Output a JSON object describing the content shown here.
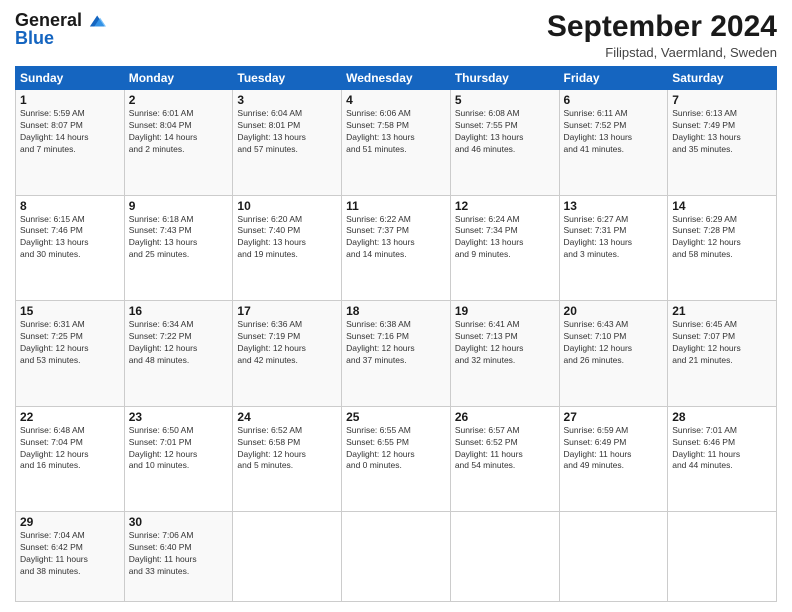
{
  "header": {
    "logo_line1": "General",
    "logo_line2": "Blue",
    "month": "September 2024",
    "location": "Filipstad, Vaermland, Sweden"
  },
  "weekdays": [
    "Sunday",
    "Monday",
    "Tuesday",
    "Wednesday",
    "Thursday",
    "Friday",
    "Saturday"
  ],
  "weeks": [
    [
      {
        "day": "1",
        "info": "Sunrise: 5:59 AM\nSunset: 8:07 PM\nDaylight: 14 hours\nand 7 minutes."
      },
      {
        "day": "2",
        "info": "Sunrise: 6:01 AM\nSunset: 8:04 PM\nDaylight: 14 hours\nand 2 minutes."
      },
      {
        "day": "3",
        "info": "Sunrise: 6:04 AM\nSunset: 8:01 PM\nDaylight: 13 hours\nand 57 minutes."
      },
      {
        "day": "4",
        "info": "Sunrise: 6:06 AM\nSunset: 7:58 PM\nDaylight: 13 hours\nand 51 minutes."
      },
      {
        "day": "5",
        "info": "Sunrise: 6:08 AM\nSunset: 7:55 PM\nDaylight: 13 hours\nand 46 minutes."
      },
      {
        "day": "6",
        "info": "Sunrise: 6:11 AM\nSunset: 7:52 PM\nDaylight: 13 hours\nand 41 minutes."
      },
      {
        "day": "7",
        "info": "Sunrise: 6:13 AM\nSunset: 7:49 PM\nDaylight: 13 hours\nand 35 minutes."
      }
    ],
    [
      {
        "day": "8",
        "info": "Sunrise: 6:15 AM\nSunset: 7:46 PM\nDaylight: 13 hours\nand 30 minutes."
      },
      {
        "day": "9",
        "info": "Sunrise: 6:18 AM\nSunset: 7:43 PM\nDaylight: 13 hours\nand 25 minutes."
      },
      {
        "day": "10",
        "info": "Sunrise: 6:20 AM\nSunset: 7:40 PM\nDaylight: 13 hours\nand 19 minutes."
      },
      {
        "day": "11",
        "info": "Sunrise: 6:22 AM\nSunset: 7:37 PM\nDaylight: 13 hours\nand 14 minutes."
      },
      {
        "day": "12",
        "info": "Sunrise: 6:24 AM\nSunset: 7:34 PM\nDaylight: 13 hours\nand 9 minutes."
      },
      {
        "day": "13",
        "info": "Sunrise: 6:27 AM\nSunset: 7:31 PM\nDaylight: 13 hours\nand 3 minutes."
      },
      {
        "day": "14",
        "info": "Sunrise: 6:29 AM\nSunset: 7:28 PM\nDaylight: 12 hours\nand 58 minutes."
      }
    ],
    [
      {
        "day": "15",
        "info": "Sunrise: 6:31 AM\nSunset: 7:25 PM\nDaylight: 12 hours\nand 53 minutes."
      },
      {
        "day": "16",
        "info": "Sunrise: 6:34 AM\nSunset: 7:22 PM\nDaylight: 12 hours\nand 48 minutes."
      },
      {
        "day": "17",
        "info": "Sunrise: 6:36 AM\nSunset: 7:19 PM\nDaylight: 12 hours\nand 42 minutes."
      },
      {
        "day": "18",
        "info": "Sunrise: 6:38 AM\nSunset: 7:16 PM\nDaylight: 12 hours\nand 37 minutes."
      },
      {
        "day": "19",
        "info": "Sunrise: 6:41 AM\nSunset: 7:13 PM\nDaylight: 12 hours\nand 32 minutes."
      },
      {
        "day": "20",
        "info": "Sunrise: 6:43 AM\nSunset: 7:10 PM\nDaylight: 12 hours\nand 26 minutes."
      },
      {
        "day": "21",
        "info": "Sunrise: 6:45 AM\nSunset: 7:07 PM\nDaylight: 12 hours\nand 21 minutes."
      }
    ],
    [
      {
        "day": "22",
        "info": "Sunrise: 6:48 AM\nSunset: 7:04 PM\nDaylight: 12 hours\nand 16 minutes."
      },
      {
        "day": "23",
        "info": "Sunrise: 6:50 AM\nSunset: 7:01 PM\nDaylight: 12 hours\nand 10 minutes."
      },
      {
        "day": "24",
        "info": "Sunrise: 6:52 AM\nSunset: 6:58 PM\nDaylight: 12 hours\nand 5 minutes."
      },
      {
        "day": "25",
        "info": "Sunrise: 6:55 AM\nSunset: 6:55 PM\nDaylight: 12 hours\nand 0 minutes."
      },
      {
        "day": "26",
        "info": "Sunrise: 6:57 AM\nSunset: 6:52 PM\nDaylight: 11 hours\nand 54 minutes."
      },
      {
        "day": "27",
        "info": "Sunrise: 6:59 AM\nSunset: 6:49 PM\nDaylight: 11 hours\nand 49 minutes."
      },
      {
        "day": "28",
        "info": "Sunrise: 7:01 AM\nSunset: 6:46 PM\nDaylight: 11 hours\nand 44 minutes."
      }
    ],
    [
      {
        "day": "29",
        "info": "Sunrise: 7:04 AM\nSunset: 6:42 PM\nDaylight: 11 hours\nand 38 minutes."
      },
      {
        "day": "30",
        "info": "Sunrise: 7:06 AM\nSunset: 6:40 PM\nDaylight: 11 hours\nand 33 minutes."
      },
      null,
      null,
      null,
      null,
      null
    ]
  ]
}
